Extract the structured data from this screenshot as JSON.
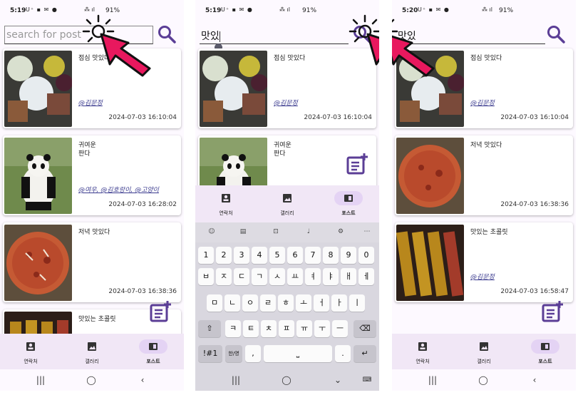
{
  "status_bar": {
    "screen1": {
      "time": "5:19",
      "battery": "91%"
    },
    "screen2": {
      "time": "5:19",
      "battery": "91%"
    },
    "screen3": {
      "time": "5:20",
      "battery": "91%"
    },
    "icons": "U⁺ ▪ ✉ ●",
    "signal": "⁂ ıl"
  },
  "search": {
    "placeholder": "search for post",
    "query": "맛있"
  },
  "posts": [
    {
      "title": "점심 맛있다",
      "tags": "@김문정",
      "date": "2024-07-03 16:10:04",
      "image": "food-plate-photo"
    },
    {
      "title": "귀여운\n판다",
      "tags": "@여우, @김호랑이, @고양이",
      "date": "2024-07-03 16:28:02",
      "image": "panda-photo"
    },
    {
      "title": "저녁 맛있다",
      "tags": "",
      "date": "2024-07-03 16:38:36",
      "image": "pizza-photo"
    },
    {
      "title": "맛있는 초콜릿",
      "tags": "@김문정",
      "date": "2024-07-03 16:58:47",
      "image": "chocolate-photo"
    }
  ],
  "results": [
    {
      "title": "점심 맛있다",
      "tags": "@김문정",
      "date": "2024-07-03 16:10:04",
      "image": "food-plate-photo"
    },
    {
      "title": "저녁 맛있다",
      "tags": "",
      "date": "2024-07-03 16:38:36",
      "image": "pizza-photo"
    },
    {
      "title": "맛있는 초콜릿",
      "tags": "@김문정",
      "date": "2024-07-03 16:58:47",
      "image": "chocolate-photo"
    }
  ],
  "screen2_posts": [
    {
      "title": "점심 맛있다",
      "tags": "@김문정",
      "date": "2024-07-03 16:10:04"
    },
    {
      "title": "귀여운\n판다",
      "tags": "",
      "date": ""
    }
  ],
  "nav": {
    "contacts": "연락처",
    "gallery": "갤러리",
    "posts": "포스트",
    "active": "posts"
  },
  "keyboard": {
    "tools": [
      "sticker-icon",
      "clipboard-icon",
      "translate-icon",
      "mic-icon",
      "settings-icon",
      "more-icon"
    ],
    "numbers": [
      "1",
      "2",
      "3",
      "4",
      "5",
      "6",
      "7",
      "8",
      "9",
      "0"
    ],
    "row1": [
      "ㅂ",
      "ㅈ",
      "ㄷ",
      "ㄱ",
      "ㅅ",
      "ㅛ",
      "ㅕ",
      "ㅑ",
      "ㅐ",
      "ㅔ"
    ],
    "row2": [
      "ㅁ",
      "ㄴ",
      "ㅇ",
      "ㄹ",
      "ㅎ",
      "ㅗ",
      "ㅓ",
      "ㅏ",
      "ㅣ"
    ],
    "row3": [
      "ㅋ",
      "ㅌ",
      "ㅊ",
      "ㅍ",
      "ㅠ",
      "ㅜ",
      "ㅡ"
    ],
    "symbols_key": "!#1",
    "lang_key": "한/영",
    "comma": ",",
    "period": "."
  },
  "colors": {
    "accent": "#5b3e96",
    "pointer": "#e8185e",
    "nav_bg": "#f1e7f6",
    "pill": "#e4d3f4",
    "link": "#3b3b8f"
  }
}
